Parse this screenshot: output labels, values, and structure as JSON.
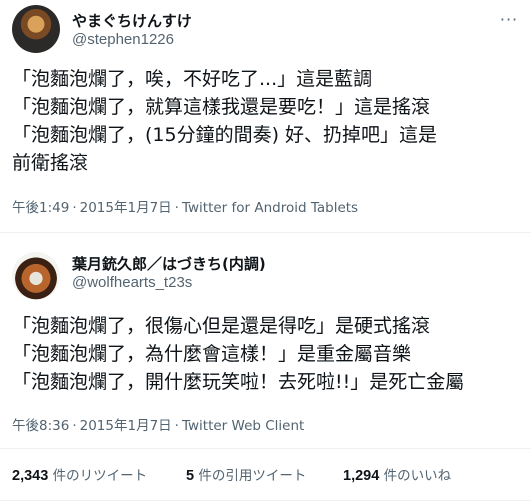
{
  "tweets": [
    {
      "display_name": "やまぐちけんすけ",
      "handle": "@stephen1226",
      "more_icon": "more-dots-icon",
      "lines": [
        "「泡麵泡爛了，唉，不好吃了...」這是藍調",
        "「泡麵泡爛了，就算這樣我還是要吃！」這是搖滾",
        "「泡麵泡爛了，(15分鐘的間奏) 好、扔掉吧」這是",
        "前衛搖滾"
      ],
      "time": "午後1:49",
      "date": "2015年1月7日",
      "source": "Twitter for Android Tablets"
    },
    {
      "display_name": "葉月銃久郎／はづきち(内調)",
      "handle": "@wolfhearts_t23s",
      "lines": [
        "「泡麵泡爛了，很傷心但是還是得吃」是硬式搖滾",
        "「泡麵泡爛了，為什麼會這樣！」是重金屬音樂",
        "「泡麵泡爛了，開什麼玩笑啦！去死啦!!」是死亡金屬"
      ],
      "time": "午後8:36",
      "date": "2015年1月7日",
      "source": "Twitter Web Client"
    }
  ],
  "separator": "·",
  "stats": {
    "retweets_count": "2,343",
    "retweets_label": "件のリツイート",
    "quotes_count": "5",
    "quotes_label": "件の引用ツイート",
    "likes_count": "1,294",
    "likes_label": "件のいいね"
  },
  "colors": {
    "text_primary": "#0f1419",
    "text_secondary": "#536471",
    "divider": "#eff3f4"
  }
}
